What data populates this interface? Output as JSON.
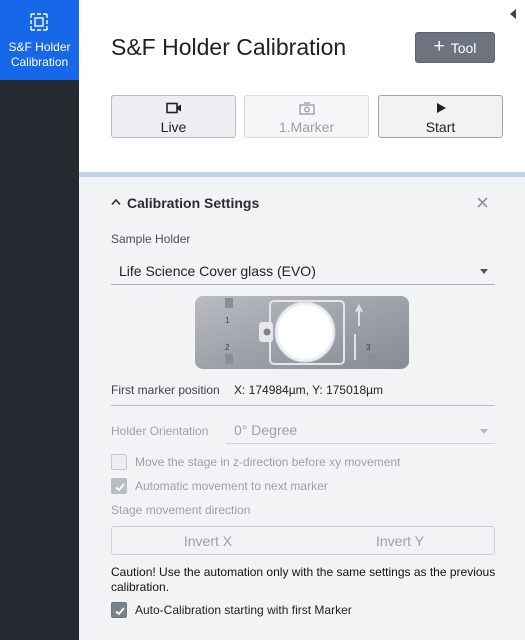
{
  "sidebar": {
    "active_item": {
      "label_line1": "S&F Holder",
      "label_line2": "Calibration",
      "icon": "calibration-frame-icon"
    }
  },
  "header": {
    "title": "S&F Holder Calibration",
    "tool_button": {
      "label": "Tool",
      "icon": "plus-icon"
    },
    "mode_buttons": [
      {
        "label": "Live",
        "icon": "camera-icon",
        "state": "normal"
      },
      {
        "label": "1.Marker",
        "icon": "marker-icon",
        "state": "disabled"
      },
      {
        "label": "Start",
        "icon": "play-icon",
        "state": "normal"
      }
    ]
  },
  "settings": {
    "section_title": "Calibration Settings",
    "sample_holder_label": "Sample Holder",
    "sample_holder_value": "Life Science Cover glass (EVO)",
    "holder_markers": [
      "1",
      "2",
      "3"
    ],
    "first_marker_label": "First marker position",
    "first_marker_value": "X: 174984µm, Y: 175018µm",
    "orientation_label": "Holder Orientation",
    "orientation_value": "0° Degree",
    "checkbox_z_move": {
      "label": "Move the stage in z-direction before xy movement",
      "checked": false,
      "enabled": false
    },
    "checkbox_auto_next": {
      "label": "Automatic movement to next marker",
      "checked": true,
      "enabled": false
    },
    "direction_label": "Stage movement direction",
    "invert_x": "Invert X",
    "invert_y": "Invert Y",
    "caution_text": "Caution! Use the automation only with the same settings as the previous calibration.",
    "checkbox_auto_calib": {
      "label": "Auto-Calibration starting with first Marker",
      "checked": true,
      "enabled": true
    }
  },
  "colors": {
    "accent": "#1668e8",
    "sidebar_bg": "#262a30",
    "tool_button": "#6d7480"
  }
}
